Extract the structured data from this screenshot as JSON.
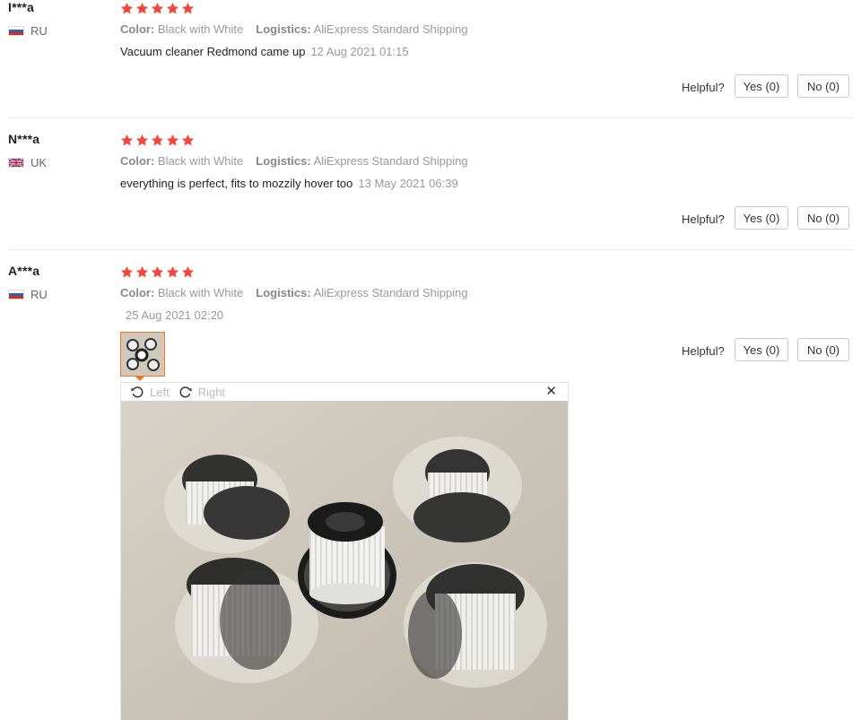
{
  "labels": {
    "color_label": "Color:",
    "logistics_label": "Logistics:",
    "helpful_label": "Helpful?",
    "yes_label": "Yes (0)",
    "no_label": "No (0)"
  },
  "reviews": [
    {
      "user": "I***a",
      "country": "RU",
      "color": "Black with White",
      "logistics": "AliExpress Standard Shipping",
      "text": "Vacuum cleaner Redmond came up",
      "date": "12 Aug 2021 01:15"
    },
    {
      "user": "N***a",
      "country": "UK",
      "color": "Black with White",
      "logistics": "AliExpress Standard Shipping",
      "text": "everything is perfect, fits to mozzily hover too",
      "date": "13 May 2021 06:39"
    },
    {
      "user": "A***a",
      "country": "RU",
      "color": "Black with White",
      "logistics": "AliExpress Standard Shipping",
      "text": "",
      "date": "25 Aug 2021 02:20"
    }
  ],
  "viewer": {
    "rotate_left_label": "Left",
    "rotate_right_label": "Right",
    "close_glyph": "✕"
  },
  "colors": {
    "star": "#f4473b",
    "thumb_border": "#f07a23"
  },
  "icons": [
    "star-icon",
    "flag-ru-icon",
    "flag-uk-icon",
    "rotate-left-icon",
    "rotate-right-icon",
    "close-icon"
  ]
}
